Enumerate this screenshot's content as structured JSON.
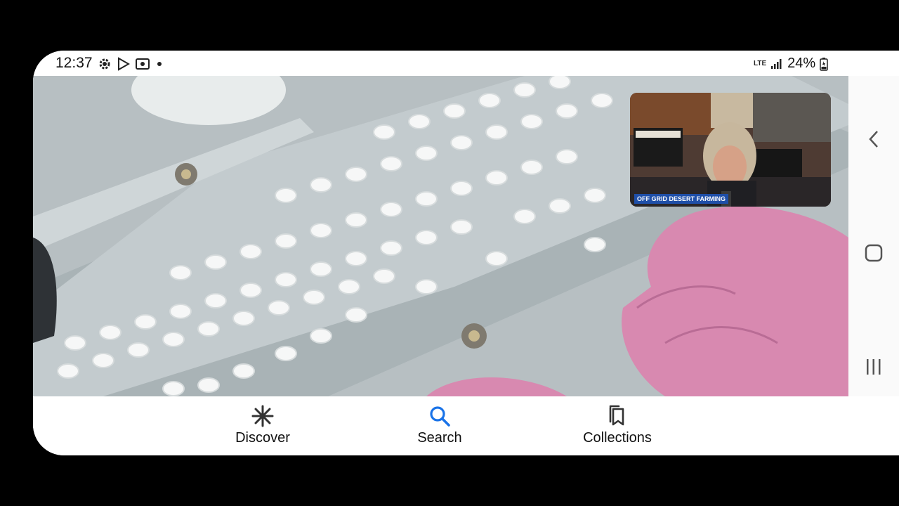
{
  "status_bar": {
    "time": "12:37",
    "network": "LTE",
    "battery_percent": "24%"
  },
  "pip": {
    "banner": "OFF GRID DESERT FARMING"
  },
  "bottom_nav": {
    "discover_label": "Discover",
    "search_label": "Search",
    "collections_label": "Collections"
  },
  "colors": {
    "accent": "#1a73e8",
    "glove": "#d889b0"
  }
}
